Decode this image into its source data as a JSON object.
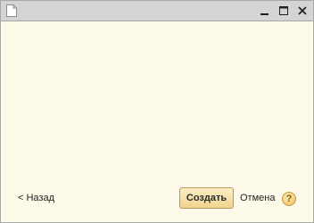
{
  "titlebar": {
    "icons": {
      "document": "document-icon",
      "minimize": "minimize-icon",
      "maximize": "maximize-icon",
      "close": "close-icon"
    }
  },
  "footer": {
    "back_label": "< Назад",
    "create_label": "Создать",
    "cancel_label": "Отмена",
    "help_label": "?"
  },
  "colors": {
    "background": "#fdfaea",
    "titlebar": "#d4d4d4",
    "primary_button": "#f1d48e",
    "help_icon": "#f0c060"
  }
}
